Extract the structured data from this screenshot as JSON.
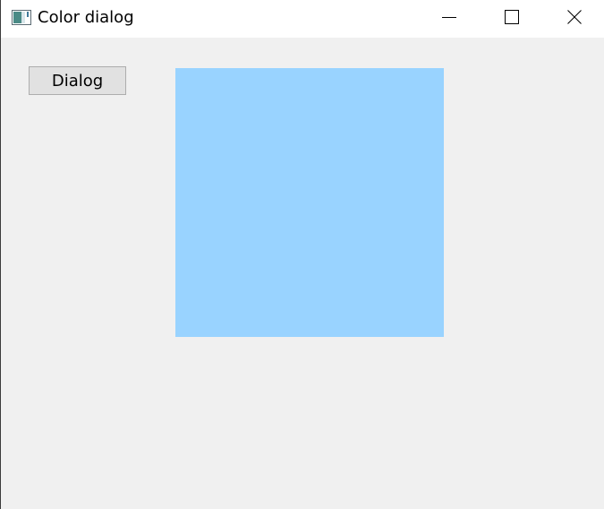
{
  "window": {
    "title": "Color dialog"
  },
  "toolbar": {
    "dialog_label": "Dialog"
  },
  "swatch": {
    "color": "#99d3ff"
  },
  "icons": {
    "app": "app-window-icon",
    "minimize": "minimize-icon",
    "maximize": "maximize-icon",
    "close": "close-icon"
  }
}
